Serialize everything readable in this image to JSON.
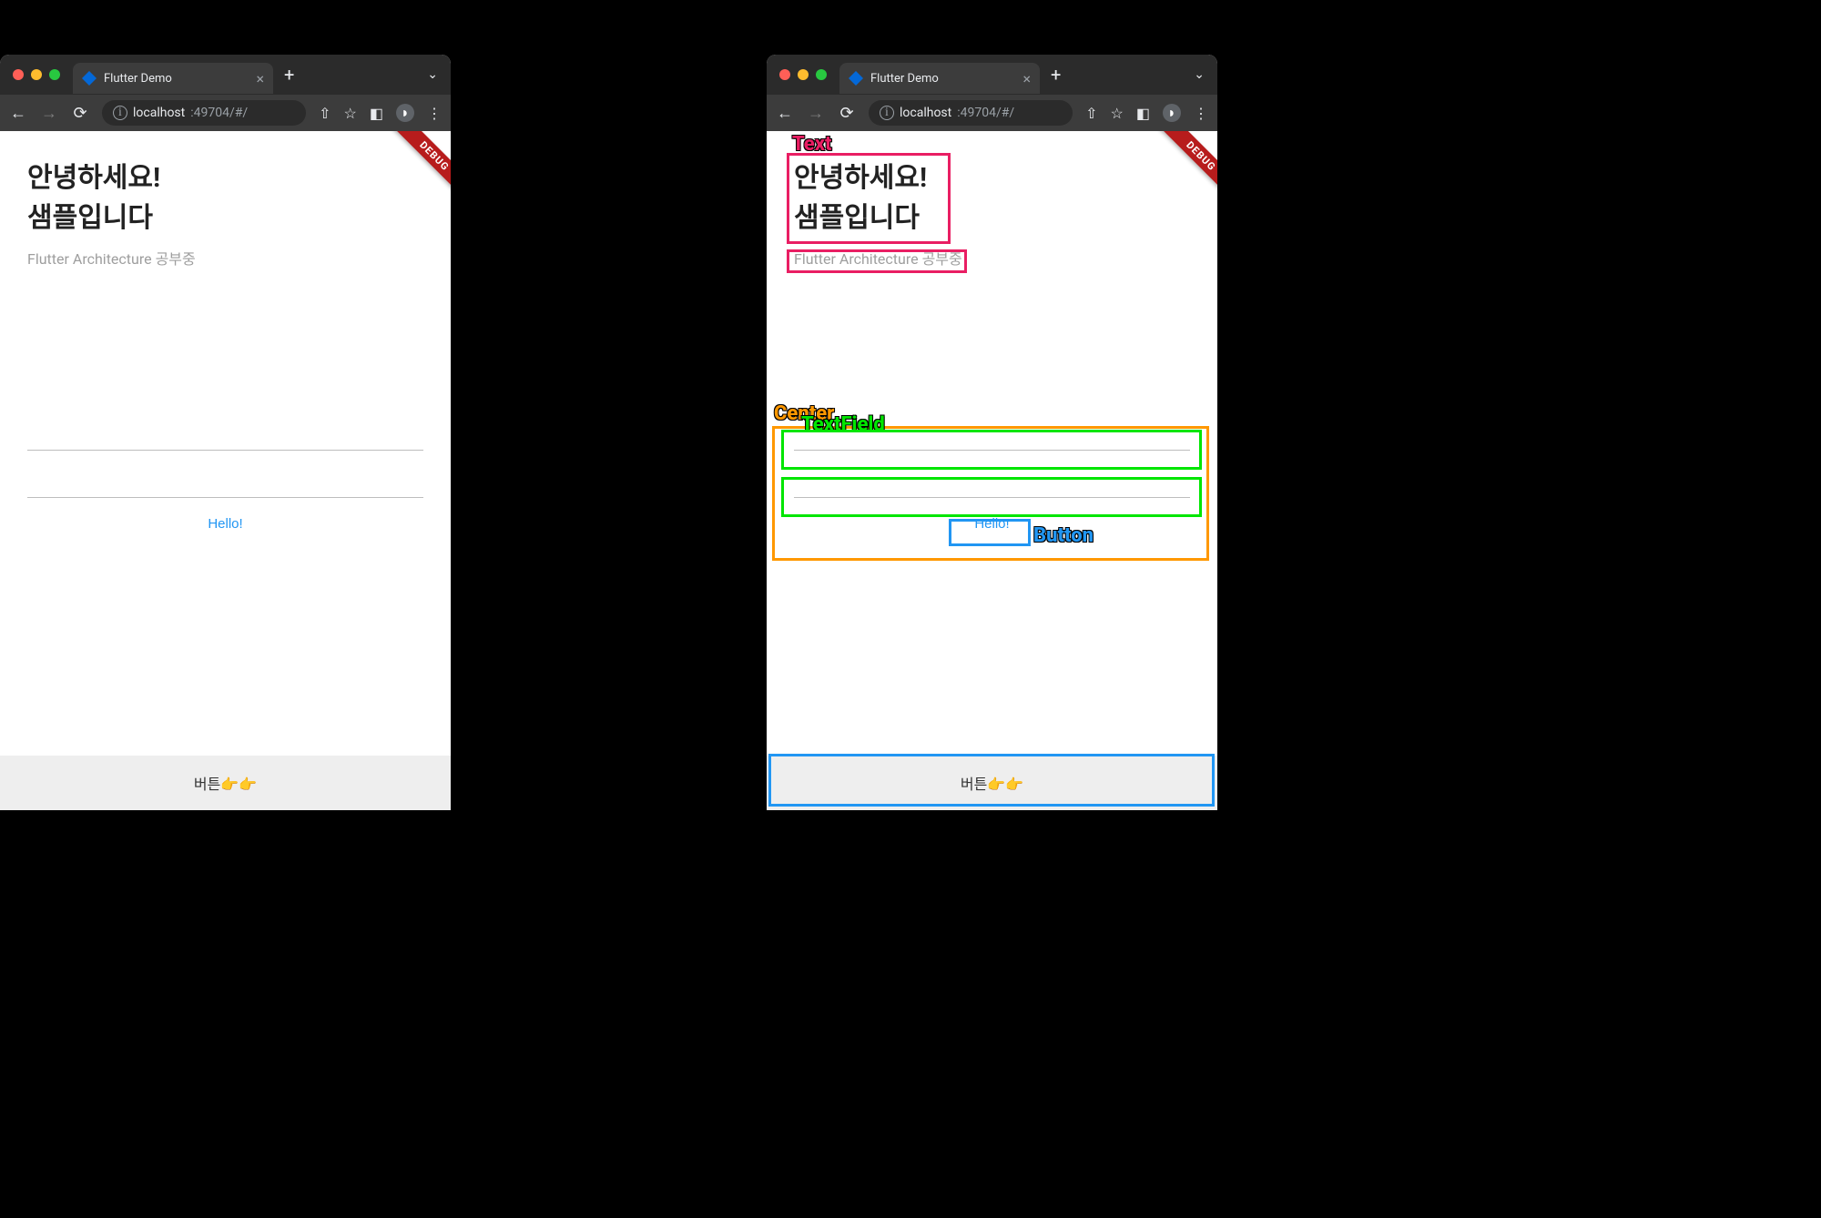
{
  "browser": {
    "tab_title": "Flutter Demo",
    "url_host": "localhost",
    "url_rest": ":49704/#/"
  },
  "app": {
    "debug_label": "DEBUG",
    "headline_line1": "안녕하세요!",
    "headline_line2": "샘플입니다",
    "subtext": "Flutter Architecture 공부중",
    "hello_button": "Hello!",
    "bottom_button": "버튼👉👉"
  },
  "annotations": {
    "text_label": "Text",
    "center_label": "Center",
    "textfield_label": "TextField",
    "button_label": "Button"
  }
}
